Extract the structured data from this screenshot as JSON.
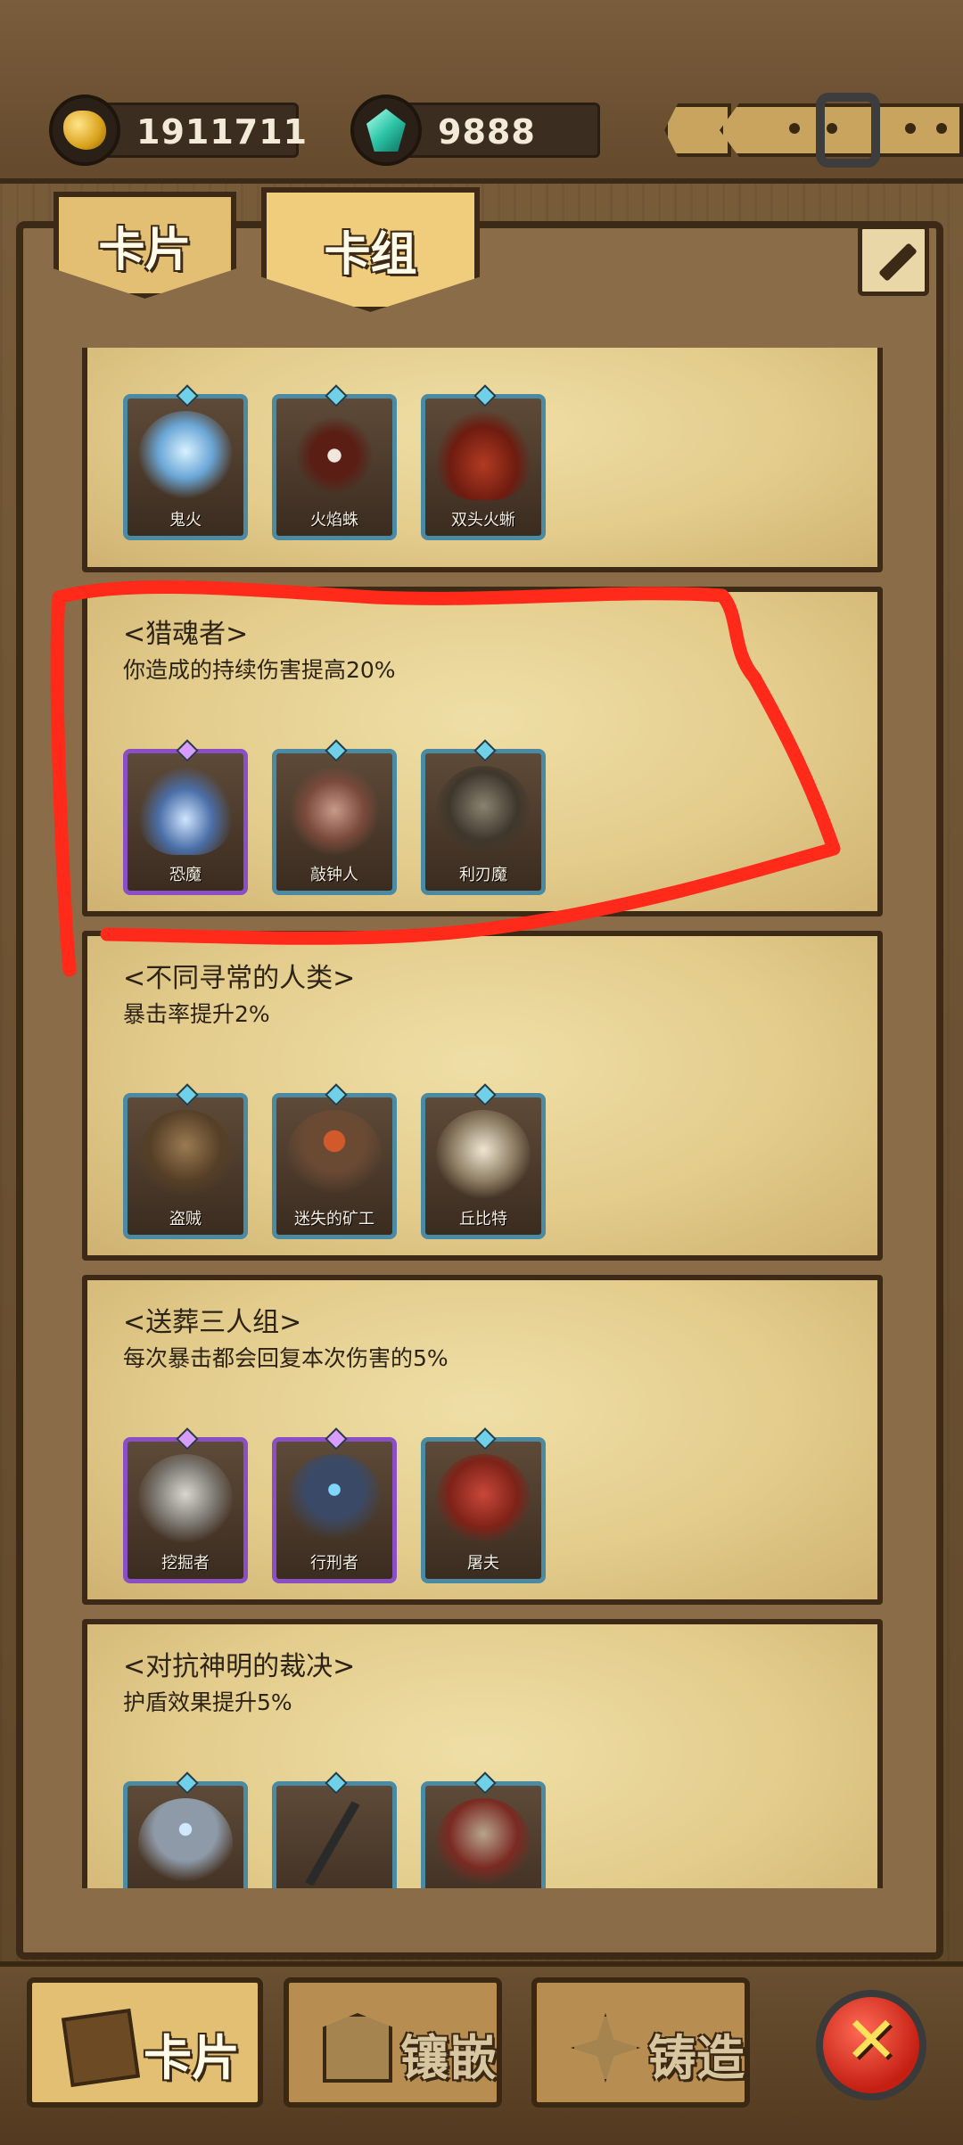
{
  "currencies": {
    "gold": "1911711",
    "gems": "9888"
  },
  "tabs": {
    "cards": "卡片",
    "decks": "卡组"
  },
  "decks": [
    {
      "name": "",
      "desc": "",
      "cards": [
        {
          "label": "鬼火",
          "rarity": "blue",
          "icon": "wisp-icon"
        },
        {
          "label": "火焰蛛",
          "rarity": "blue",
          "icon": "spider-icon"
        },
        {
          "label": "双头火蜥",
          "rarity": "blue",
          "icon": "salamander-icon"
        }
      ]
    },
    {
      "name": "<猎魂者>",
      "desc": "你造成的持续伤害提高20%",
      "cards": [
        {
          "label": "恐魔",
          "rarity": "purple",
          "icon": "horror-icon"
        },
        {
          "label": "敲钟人",
          "rarity": "blue",
          "icon": "bellringer-icon"
        },
        {
          "label": "利刃魔",
          "rarity": "blue",
          "icon": "blade-demon-icon"
        }
      ]
    },
    {
      "name": "<不同寻常的人类>",
      "desc": "暴击率提升2%",
      "cards": [
        {
          "label": "盗贼",
          "rarity": "blue",
          "icon": "thief-icon"
        },
        {
          "label": "迷失的矿工",
          "rarity": "blue",
          "icon": "miner-icon"
        },
        {
          "label": "丘比特",
          "rarity": "blue",
          "icon": "cupid-icon"
        }
      ]
    },
    {
      "name": "<送葬三人组>",
      "desc": "每次暴击都会回复本次伤害的5%",
      "cards": [
        {
          "label": "挖掘者",
          "rarity": "purple",
          "icon": "digger-icon"
        },
        {
          "label": "行刑者",
          "rarity": "purple",
          "icon": "executioner-icon"
        },
        {
          "label": "屠夫",
          "rarity": "blue",
          "icon": "butcher-icon"
        }
      ]
    },
    {
      "name": "<对抗神明的裁决>",
      "desc": "护盾效果提升5%",
      "cards": [
        {
          "label": "",
          "rarity": "blue",
          "icon": "knight-icon"
        },
        {
          "label": "",
          "rarity": "blue",
          "icon": "sword-icon"
        },
        {
          "label": "",
          "rarity": "blue",
          "icon": "warrior-icon"
        }
      ]
    }
  ],
  "bottom_nav": {
    "cards": "卡片",
    "inlay": "镶嵌",
    "forge": "铸造"
  },
  "colors": {
    "annotation": "#ff2a1a",
    "blue_frame": "#4b8aa3",
    "purple_frame": "#8a4fc4"
  }
}
